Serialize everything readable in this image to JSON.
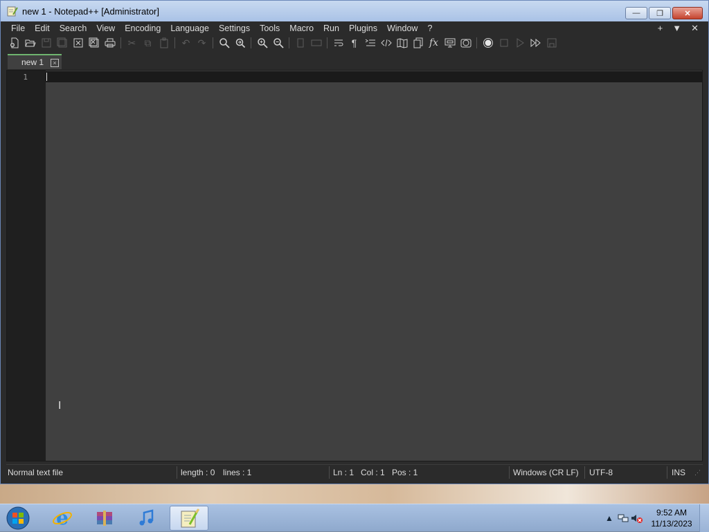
{
  "window": {
    "title": "new 1 - Notepad++ [Administrator]",
    "buttons": {
      "minimize": "—",
      "maximize": "❐",
      "close": "✕"
    }
  },
  "menu": {
    "items": [
      "File",
      "Edit",
      "Search",
      "View",
      "Encoding",
      "Language",
      "Settings",
      "Tools",
      "Macro",
      "Run",
      "Plugins",
      "Window",
      "?"
    ],
    "right": {
      "add": "+",
      "dropdown": "▼",
      "close": "✕"
    }
  },
  "tabs": [
    {
      "label": "new 1",
      "close": "×"
    }
  ],
  "editor": {
    "line_numbers": [
      "1"
    ],
    "content": ""
  },
  "status": {
    "file_type": "Normal text file",
    "length": "length : 0",
    "lines": "lines : 1",
    "ln": "Ln : 1",
    "col": "Col : 1",
    "pos": "Pos : 1",
    "eol": "Windows (CR LF)",
    "encoding": "UTF-8",
    "mode": "INS"
  },
  "taskbar": {
    "clock_time": "9:52 AM",
    "clock_date": "11/13/2023",
    "apps": [
      "internet-explorer-icon",
      "archive-icon",
      "itunes-icon",
      "notepadplusplus-icon"
    ]
  },
  "colors": {
    "chrome": "#2b2b2b",
    "editor_bg": "#404040",
    "tab_accent": "#6fb56f"
  }
}
